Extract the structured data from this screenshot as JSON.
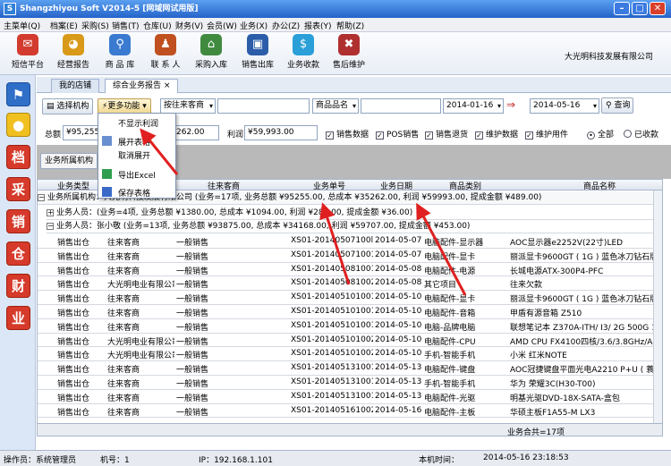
{
  "window": {
    "title": "Shangzhiyou Soft V2014-5 [网域网试用版]"
  },
  "menu": [
    "主菜单(Q)",
    "档案(E)",
    "采购(S)",
    "销售(T)",
    "仓库(U)",
    "财务(V)",
    "会员(W)",
    "业务(X)",
    "办公(Z)",
    "报表(Y)",
    "帮助(Z)"
  ],
  "toolbar": [
    {
      "label": "短信平台",
      "icon": "mail-icon",
      "color": "#d23b2e",
      "glyph": "✉"
    },
    {
      "label": "经营报告",
      "icon": "pie-chart-icon",
      "color": "#d89a18",
      "glyph": "◕"
    },
    {
      "label": "商 品 库",
      "icon": "magnifier-icon",
      "color": "#3a7ad0",
      "glyph": "⚲"
    },
    {
      "label": "联 系 人",
      "icon": "person-icon",
      "color": "#c05020",
      "glyph": "♟"
    },
    {
      "label": "采购入库",
      "icon": "house-icon",
      "color": "#3f8a3f",
      "glyph": "⌂"
    },
    {
      "label": "销售出库",
      "icon": "monitor-icon",
      "color": "#2b5da8",
      "glyph": "▣"
    },
    {
      "label": "业务收款",
      "icon": "dollar-icon",
      "color": "#2a9fd8",
      "glyph": "$"
    },
    {
      "label": "售后维护",
      "icon": "tools-icon",
      "color": "#b03030",
      "glyph": "✖"
    }
  ],
  "company": "大光明科技发展有限公司",
  "sidebar": [
    "档",
    "采",
    "销",
    "仓",
    "财",
    "业"
  ],
  "tabs": {
    "home": "我的店铺",
    "report": "综合业务报告",
    "close": "×"
  },
  "filters": {
    "choose_org": "选择机构",
    "more": "更多功能",
    "by_customer": "按往来客商",
    "product_name": "商品品名",
    "start_date": "2014-01-16",
    "end_date": "2014-05-16",
    "query": "查询"
  },
  "summary": {
    "total_label": "总额",
    "total_value": "¥95,255",
    "cost_value": "262.00",
    "profit_label": "利润",
    "profit_value": "¥59,993.00"
  },
  "checks": [
    {
      "label": "销售数据",
      "checked": true
    },
    {
      "label": "POS销售",
      "checked": true
    },
    {
      "label": "销售退货",
      "checked": true
    },
    {
      "label": "维护数据",
      "checked": true
    },
    {
      "label": "维护用件",
      "checked": true
    }
  ],
  "radios": [
    {
      "label": "全部",
      "checked": true
    },
    {
      "label": "已收款",
      "checked": false
    }
  ],
  "group_bar": "业务所属机构",
  "dropdown": [
    "不显示利润",
    "展开表格",
    "取消展开",
    "导出Excel",
    "保存表格"
  ],
  "columns": [
    "业务类型",
    "往来客商",
    "业务单号",
    "业务日期",
    "商品类别",
    "商品名称"
  ],
  "groups": {
    "org": "业务所属机构：大光明科技发展有限公司 (业务=17项, 业务总额 ¥95255.00, 总成本 ¥35262.00, 利润 ¥59993.00, 提成金额 ¥489.00)",
    "org_short": "业务所属机构：",
    "person1": "业务人员：(业务=4项, 业务总额 ¥1380.00, 总成本 ¥1094.00, 利润 ¥286.00, 提成金额 ¥36.00)",
    "person2": "业务人员：张小敬 (业务=13项, 业务总额 ¥93875.00, 总成本 ¥34168.00, 利润 ¥59707.00, 提成金额 ¥453.00)"
  },
  "rows": [
    [
      "销售出仓",
      "往来客商",
      "一般销售",
      "XS01-20140507100l",
      "2014-05-07",
      "电脑配件-显示器",
      "AOC显示器e2252V(22寸)LED"
    ],
    [
      "销售出仓",
      "往来客商",
      "一般销售",
      "XS01-201405071001",
      "2014-05-07",
      "电脑配件-显卡",
      "丽派显卡9600GT ( 1G ) 蓝色冰刀钻石版"
    ],
    [
      "销售出仓",
      "往来客商",
      "一般销售",
      "XS01-201405081001",
      "2014-05-08",
      "电脑配件-电源",
      "长城电源ATX-300P4-PFC"
    ],
    [
      "销售出仓",
      "大光明电业有限公司",
      "一般销售",
      "XS01-201405081002",
      "2014-05-08",
      "其它项目",
      "往来欠款"
    ],
    [
      "销售出仓",
      "往来客商",
      "一般销售",
      "XS01-201405101001",
      "2014-05-10",
      "电脑配件-显卡",
      "丽派显卡9600GT ( 1G ) 蓝色冰刀钻石版"
    ],
    [
      "销售出仓",
      "往来客商",
      "一般销售",
      "XS01-201405101001",
      "2014-05-10",
      "电脑配件-音箱",
      "甲盾有源音箱 Z510"
    ],
    [
      "销售出仓",
      "往来客商",
      "一般销售",
      "XS01-201405101001",
      "2014-05-10",
      "电脑-品牌电脑",
      "联想笔记本 Z370A-ITH/ I3/ 2G 500G 1G"
    ],
    [
      "销售出仓",
      "大光明电业有限公司",
      "一般销售",
      "XS01-201405101002",
      "2014-05-10",
      "电脑配件-CPU",
      "AMD CPU FX4100四核/3.6/3.8GHz/AM3+"
    ],
    [
      "销售出仓",
      "大光明电业有限公司",
      "一般销售",
      "XS01-201405101002",
      "2014-05-10",
      "手机-智能手机",
      "小米 红米NOTE"
    ],
    [
      "销售出仓",
      "往来客商",
      "一般销售",
      "XS01-201405131001",
      "2014-05-13",
      "电脑配件-键盘",
      "AOC冠捷键盘平面光电A2210 P+U ( 蓑 )"
    ],
    [
      "销售出仓",
      "往来客商",
      "一般销售",
      "XS01-201405131001",
      "2014-05-13",
      "手机-智能手机",
      "华为 荣耀3C(H30-T00)"
    ],
    [
      "销售出仓",
      "往来客商",
      "一般销售",
      "XS01-201405131001",
      "2014-05-13",
      "电脑配件-光驱",
      "明基光驱DVD-18X-SATA-盒包"
    ],
    [
      "销售出仓",
      "往来客商",
      "一般销售",
      "XS01-201405161002",
      "2014-05-16",
      "电脑配件-主板",
      "华硕主板F1A55-M LX3"
    ]
  ],
  "footer": {
    "count": "业务合共=17项"
  },
  "status": {
    "operator": "操作员：系统管理员",
    "machine": "机号：1",
    "ip": "IP：192.168.1.101",
    "time_label": "本机时间：",
    "time": "2014-05-16 23:18:53"
  }
}
